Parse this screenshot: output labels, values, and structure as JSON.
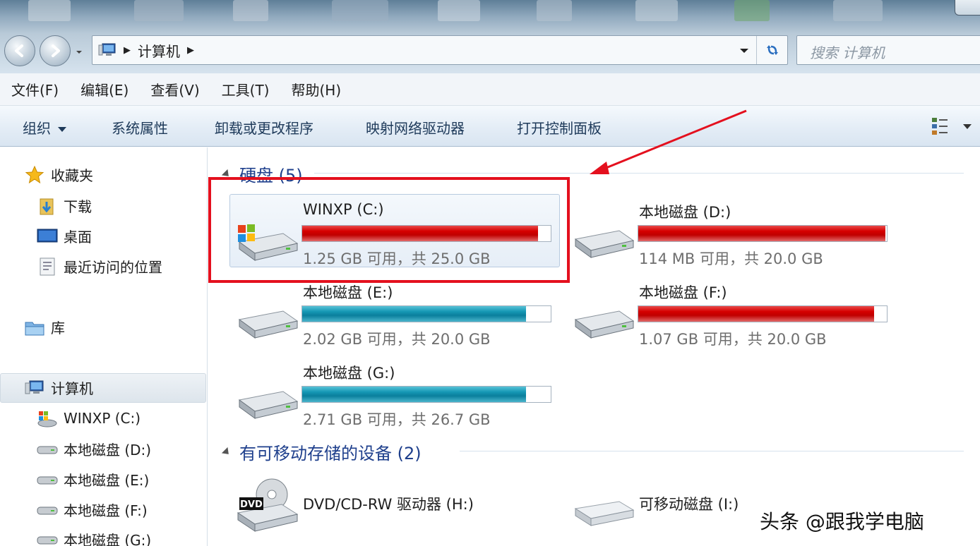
{
  "address": {
    "crumb": "计算机",
    "search_placeholder": "搜索 计算机"
  },
  "menu": [
    "文件(F)",
    "编辑(E)",
    "查看(V)",
    "工具(T)",
    "帮助(H)"
  ],
  "commands": {
    "organize": "组织",
    "system_properties": "系统属性",
    "uninstall": "卸载或更改程序",
    "map_drive": "映射网络驱动器",
    "control_panel": "打开控制面板"
  },
  "nav": {
    "favorites": "收藏夹",
    "downloads": "下载",
    "desktop": "桌面",
    "recent": "最近访问的位置",
    "libraries": "库",
    "computer": "计算机",
    "drives": [
      "WINXP (C:)",
      "本地磁盘 (D:)",
      "本地磁盘 (E:)",
      "本地磁盘 (F:)",
      "本地磁盘 (G:)"
    ]
  },
  "groups": {
    "hard_disks": "硬盘 (5)",
    "removable": "有可移动存储的设备 (2)"
  },
  "drives": [
    {
      "name": "WINXP (C:)",
      "free": "1.25 GB 可用，共 25.0 GB",
      "used_fraction": 0.95,
      "color": "red"
    },
    {
      "name": "本地磁盘 (D:)",
      "free": "114 MB 可用，共 20.0 GB",
      "used_fraction": 0.995,
      "color": "red"
    },
    {
      "name": "本地磁盘 (E:)",
      "free": "2.02 GB 可用，共 20.0 GB",
      "used_fraction": 0.9,
      "color": "teal"
    },
    {
      "name": "本地磁盘 (F:)",
      "free": "1.07 GB 可用，共 20.0 GB",
      "used_fraction": 0.95,
      "color": "red"
    },
    {
      "name": "本地磁盘 (G:)",
      "free": "2.71 GB 可用，共 26.7 GB",
      "used_fraction": 0.9,
      "color": "teal"
    }
  ],
  "removable": [
    {
      "name": "DVD/CD-RW 驱动器 (H:)",
      "badge": "DVD"
    },
    {
      "name": "可移动磁盘 (I:)"
    }
  ],
  "watermark": "头条 @跟我学电脑",
  "colors": {
    "accent": "#1e3f8c",
    "highlight_box": "#e4101e"
  }
}
